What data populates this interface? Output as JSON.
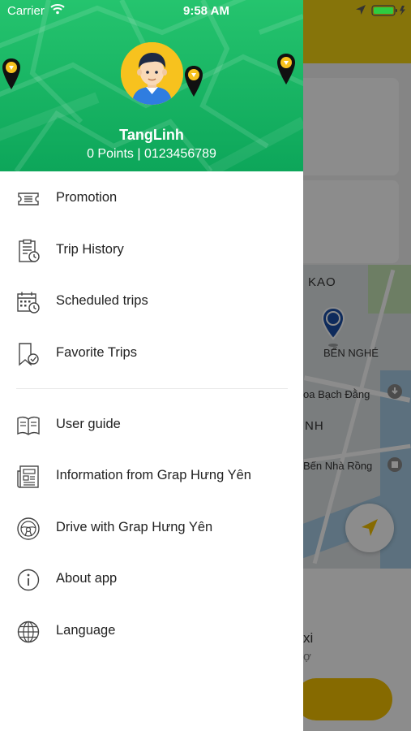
{
  "status_bar": {
    "carrier": "Carrier",
    "time": "9:58 AM"
  },
  "profile": {
    "name": "TangLinh",
    "meta": "0 Points | 0123456789"
  },
  "menu_primary": [
    {
      "label": "Promotion",
      "icon": "coupon-icon"
    },
    {
      "label": "Trip History",
      "icon": "clipboard-clock-icon"
    },
    {
      "label": "Scheduled trips",
      "icon": "calendar-clock-icon"
    },
    {
      "label": "Favorite Trips",
      "icon": "bookmark-check-icon"
    }
  ],
  "menu_secondary": [
    {
      "label": "User guide",
      "icon": "book-icon"
    },
    {
      "label": "Information from Grap Hưng Yên",
      "icon": "newspaper-icon"
    },
    {
      "label": "Drive with Grap Hưng Yên",
      "icon": "steering-wheel-icon"
    },
    {
      "label": "About app",
      "icon": "info-icon"
    },
    {
      "label": "Language",
      "icon": "globe-icon"
    }
  ],
  "background_map": {
    "labels": [
      "KAO",
      "BẾN NGHÉ",
      "oa Bạch Đằng",
      "NH",
      "Bến Nhà Rồng",
      "xi",
      "ợ"
    ]
  },
  "colors": {
    "header_green": "#12b060",
    "accent_yellow": "#f5c200",
    "pin_blue": "#1b4fa8"
  }
}
